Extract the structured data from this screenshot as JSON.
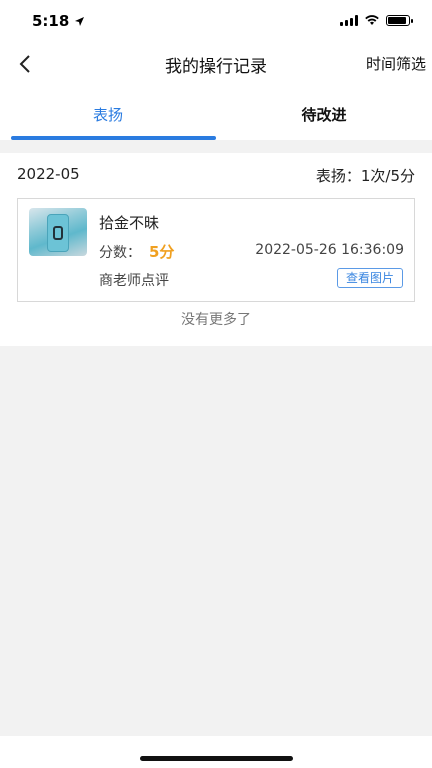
{
  "status_bar": {
    "time": "5:18"
  },
  "nav": {
    "title": "我的操行记录",
    "filter_label": "时间筛选"
  },
  "tabs": [
    {
      "label": "表扬",
      "active": true
    },
    {
      "label": "待改进",
      "active": false
    }
  ],
  "accent_color": "#2a7be0",
  "score_color": "#f0a020",
  "month_group": {
    "month": "2022-05",
    "summary": "表扬：1次/5分"
  },
  "records": [
    {
      "title": "拾金不昧",
      "score_label": "分数：",
      "score_value": "5分",
      "time": "2022-05-26 16:36:09",
      "reviewer": "商老师点评",
      "view_image_label": "查看图片"
    }
  ],
  "footer_text": "没有更多了"
}
